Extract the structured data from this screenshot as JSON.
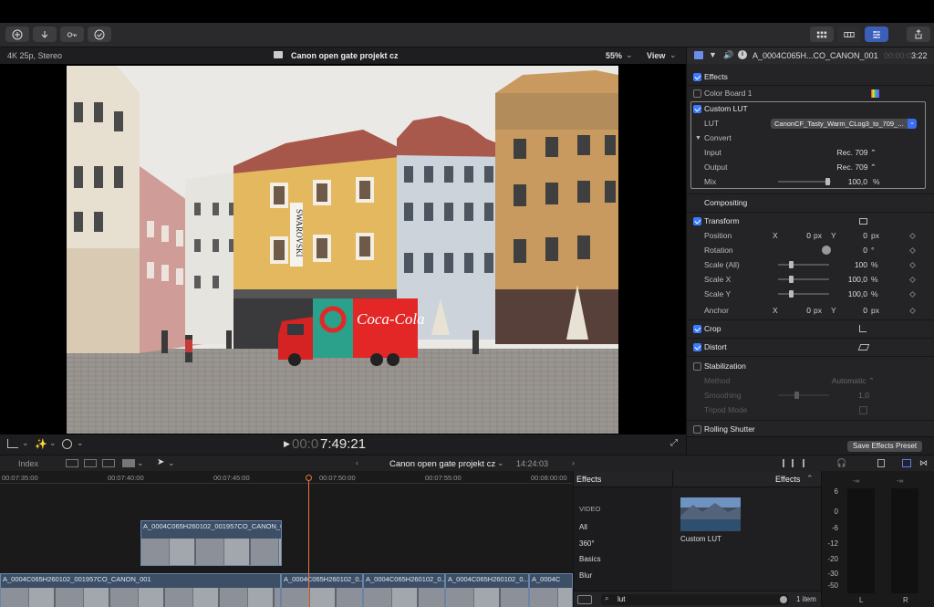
{
  "toolbar": {
    "icons": [
      "import-icon",
      "download-icon",
      "keywords-icon",
      "checkmark-icon"
    ],
    "right_icons": [
      "browser-layout-icon",
      "timeline-layout-icon",
      "inspector-layout-icon",
      "share-icon"
    ]
  },
  "viewer": {
    "format": "4K 25p, Stereo",
    "project_title": "Canon open gate projekt cz",
    "zoom": "55%",
    "view_label": "View",
    "timecode_dim": "00:0",
    "timecode": "7:49:21"
  },
  "inspector": {
    "clip_name": "A_0004C065H...CO_CANON_001",
    "duration_dim": "00:00:0",
    "duration": "3:22",
    "effects_header": "Effects",
    "color_board": "Color Board 1",
    "custom_lut": "Custom LUT",
    "lut_label": "LUT",
    "lut_value": "CanonCF_Tasty_Warm_CLog3_to_709_...",
    "convert_label": "Convert",
    "input_label": "Input",
    "input_value": "Rec. 709 ⌃",
    "output_label": "Output",
    "output_value": "Rec. 709 ⌃",
    "mix_label": "Mix",
    "mix_value": "100,0",
    "mix_unit": "%",
    "compositing": "Compositing",
    "transform": "Transform",
    "position_label": "Position",
    "x": "X",
    "y": "Y",
    "pos_x": "0",
    "pos_y": "0",
    "px": "px",
    "rotation_label": "Rotation",
    "rotation_value": "0",
    "degree": "°",
    "scale_all_label": "Scale (All)",
    "scale_all_value": "100",
    "percent": "%",
    "scale_x_label": "Scale X",
    "scale_x_value": "100,0",
    "scale_y_label": "Scale Y",
    "scale_y_value": "100,0",
    "anchor_label": "Anchor",
    "anchor_x": "0",
    "anchor_y": "0",
    "crop": "Crop",
    "distort": "Distort",
    "stabilization": "Stabilization",
    "method_label": "Method",
    "method_value": "Automatic ⌃",
    "smoothing_label": "Smoothing",
    "smoothing_value": "1,0",
    "tripod_label": "Tripod Mode",
    "rolling_shutter": "Rolling Shutter",
    "save_preset": "Save Effects Preset"
  },
  "photo_text": {
    "swarovski_banner": "SWAROVSKI",
    "truck_brand": "Coca-Cola"
  },
  "timeline": {
    "index_label": "Index",
    "project_name": "Canon open gate projekt cz",
    "project_duration": "14:24:03",
    "ruler": [
      "00:07:35:00",
      "00:07:40:00",
      "00:07:45:00",
      "00:07:50:00",
      "00:07:55:00",
      "00:08:00:00"
    ],
    "connected_clip": "A_0004C065H260102_001957CO_CANON_0...",
    "primary_clips": [
      "A_0004C065H260102_001957CO_CANON_001",
      "A_0004C065H260102_0...",
      "A_0004C065H260102_0...",
      "A_0004C065H260102_0...",
      "A_0004C"
    ]
  },
  "effects_browser": {
    "left_title": "Effects",
    "right_title": "Effects",
    "section": "VIDEO",
    "categories": [
      "All",
      "360°",
      "Basics",
      "Blur"
    ],
    "result_name": "Custom LUT",
    "search_value": "lut",
    "count": "1 item"
  },
  "meters": {
    "top_labels": [
      "-∞",
      "-∞"
    ],
    "scale": [
      "6",
      "0",
      "-6",
      "-12",
      "-20",
      "-30",
      "-50"
    ],
    "channels": [
      "L",
      "R"
    ]
  },
  "colors": {
    "accent": "#3b7bff",
    "playhead": "#e8743a",
    "clip_blue": "#3c4f66"
  }
}
